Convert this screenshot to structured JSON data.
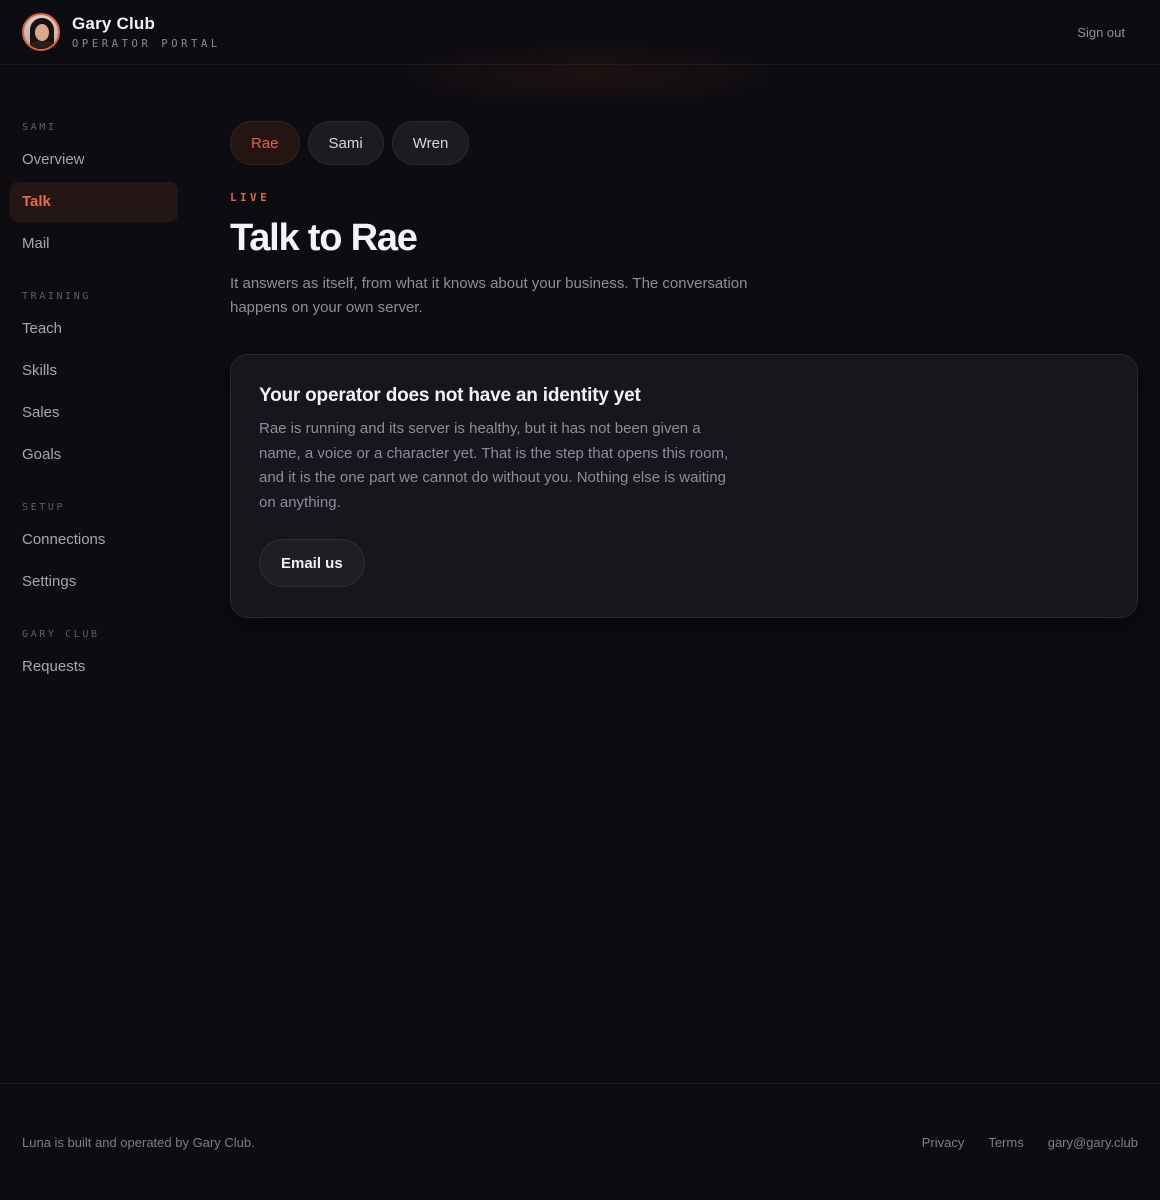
{
  "header": {
    "brand_title": "Gary Club",
    "brand_subtitle": "OPERATOR PORTAL",
    "signout_label": "Sign out"
  },
  "sidebar": {
    "sections": [
      {
        "title": "SAMI",
        "items": [
          "Overview",
          "Talk",
          "Mail"
        ]
      },
      {
        "title": "TRAINING",
        "items": [
          "Teach",
          "Skills",
          "Sales",
          "Goals"
        ]
      },
      {
        "title": "SETUP",
        "items": [
          "Connections",
          "Settings"
        ]
      },
      {
        "title": "GARY CLUB",
        "items": [
          "Requests"
        ]
      }
    ],
    "active_item": "Talk"
  },
  "main": {
    "chips": [
      "Rae",
      "Sami",
      "Wren"
    ],
    "active_chip": "Rae",
    "eyebrow": "LIVE",
    "title": "Talk to Rae",
    "lead": "It answers as itself, from what it knows about your business. The conversation happens on your own server.",
    "card": {
      "title": "Your operator does not have an identity yet",
      "body": "Rae is running and its server is healthy, but it has not been given a name, a voice or a character yet. That is the step that opens this room, and it is the one part we cannot do without you. Nothing else is waiting on anything.",
      "button_label": "Email us"
    }
  },
  "footer": {
    "note": "Luna is built and operated by Gary Club.",
    "links": [
      "Privacy",
      "Terms",
      "gary@gary.club"
    ]
  },
  "colors": {
    "accent": "#e0623f",
    "background": "#0c0c11",
    "card": "#16161d"
  }
}
